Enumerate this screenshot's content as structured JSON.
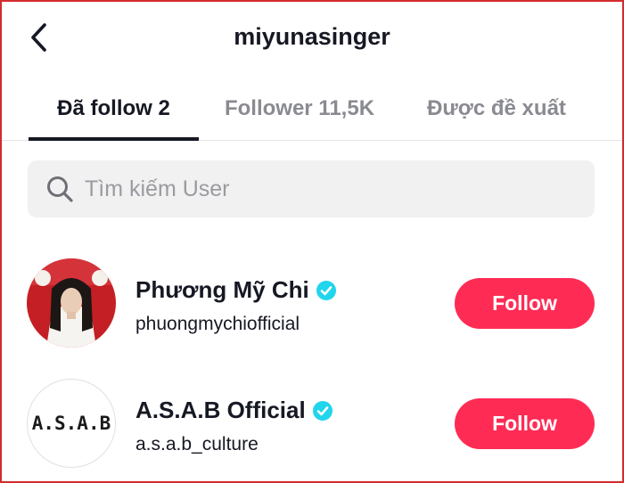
{
  "header": {
    "back_icon": "chevron-left-icon",
    "title": "miyunasinger"
  },
  "tabs": [
    {
      "label": "Đã follow 2",
      "active": true
    },
    {
      "label": "Follower 11,5K",
      "active": false
    },
    {
      "label": "Được đề xuất",
      "active": false
    }
  ],
  "search": {
    "icon": "search-icon",
    "placeholder": "Tìm kiếm User",
    "value": ""
  },
  "users": [
    {
      "name": "Phương Mỹ Chi",
      "handle": "phuongmychiofficial",
      "verified": true,
      "follow_label": "Follow",
      "avatar": "portrait-photo"
    },
    {
      "name": "A.S.A.B Official",
      "handle": "a.s.a.b_culture",
      "verified": true,
      "follow_label": "Follow",
      "avatar_text": "A.S.A.B"
    }
  ],
  "colors": {
    "accent": "#fe2c55",
    "verified": "#20d5ec",
    "text": "#161823",
    "muted": "#8a8b91"
  }
}
